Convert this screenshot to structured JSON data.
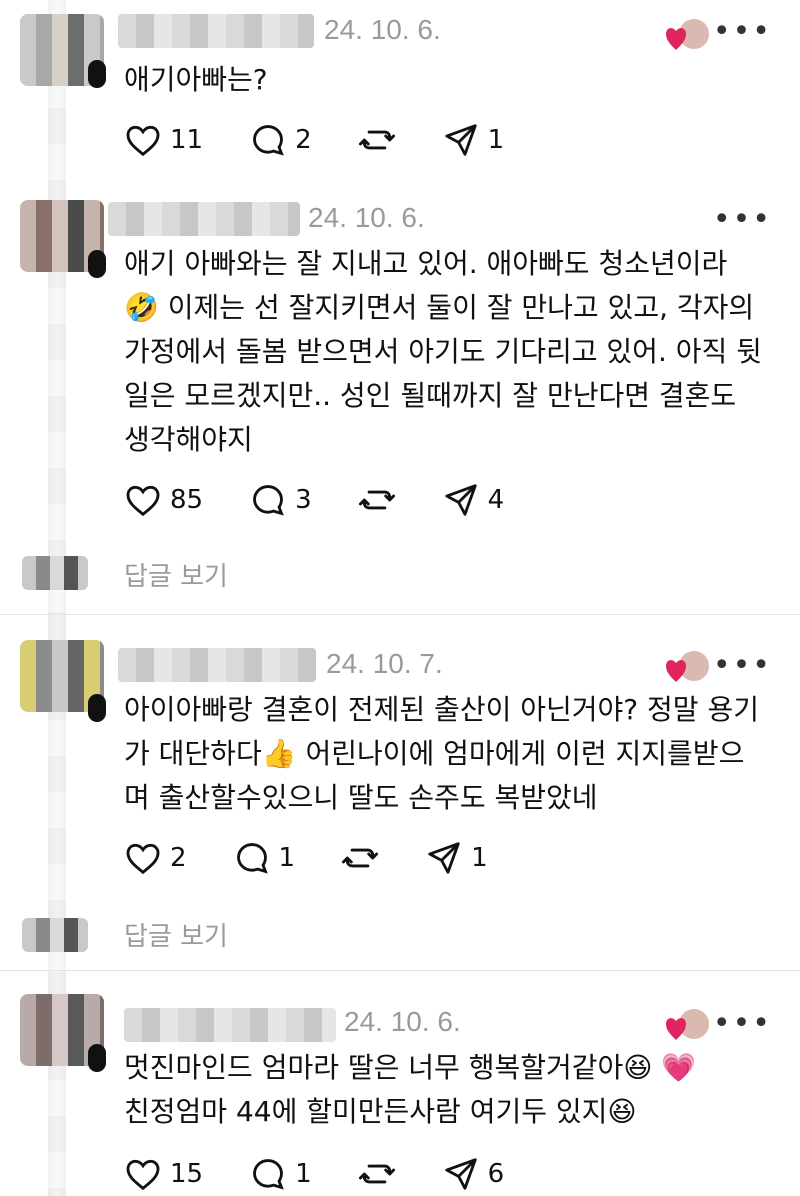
{
  "comments": [
    {
      "timestamp": "24. 10. 6.",
      "text": "애기아빠는?",
      "likes": "11",
      "replies": "2",
      "shares": "1",
      "liked_by_author": true
    },
    {
      "timestamp": "24. 10. 6.",
      "text": "애기 아빠와는 잘 지내고 있어. 애아빠도 청소년이라\n🤣 이제는 선 잘지키면서 둘이 잘 만나고 있고, 각자의\n가정에서 돌봄 받으면서 아기도 기다리고 있어. 아직 뒷\n일은 모르겠지만.. 성인 될때까지 잘 만난다면 결혼도\n생각해야지",
      "likes": "85",
      "replies": "3",
      "shares": "4",
      "liked_by_author": false,
      "reply_link": "답글 보기"
    },
    {
      "timestamp": "24. 10. 7.",
      "text": "아이아빠랑 결혼이 전제된 출산이 아닌거야? 정말 용기\n가 대단하다👍 어린나이에 엄마에게 이런 지지를받으\n며 출산할수있으니 딸도 손주도 복받았네",
      "likes": "2",
      "replies": "1",
      "shares": "1",
      "liked_by_author": true,
      "reply_link": "답글 보기"
    },
    {
      "timestamp": "24. 10. 6.",
      "text": "멋진마인드 엄마라 딸은 너무 행복할거같아😆 💗\n친정엄마 44에 할미만든사람 여기두 있지😆",
      "likes": "15",
      "replies": "1",
      "shares": "6",
      "liked_by_author": true
    }
  ],
  "icons": {
    "heart": "heart-icon",
    "comment": "comment-icon",
    "repost": "repost-icon",
    "share": "share-icon",
    "more": "more-icon"
  },
  "colors": {
    "text": "#111111",
    "muted": "#9a9a9a",
    "like_red": "#e0245e",
    "divider": "#e2e2e2"
  }
}
